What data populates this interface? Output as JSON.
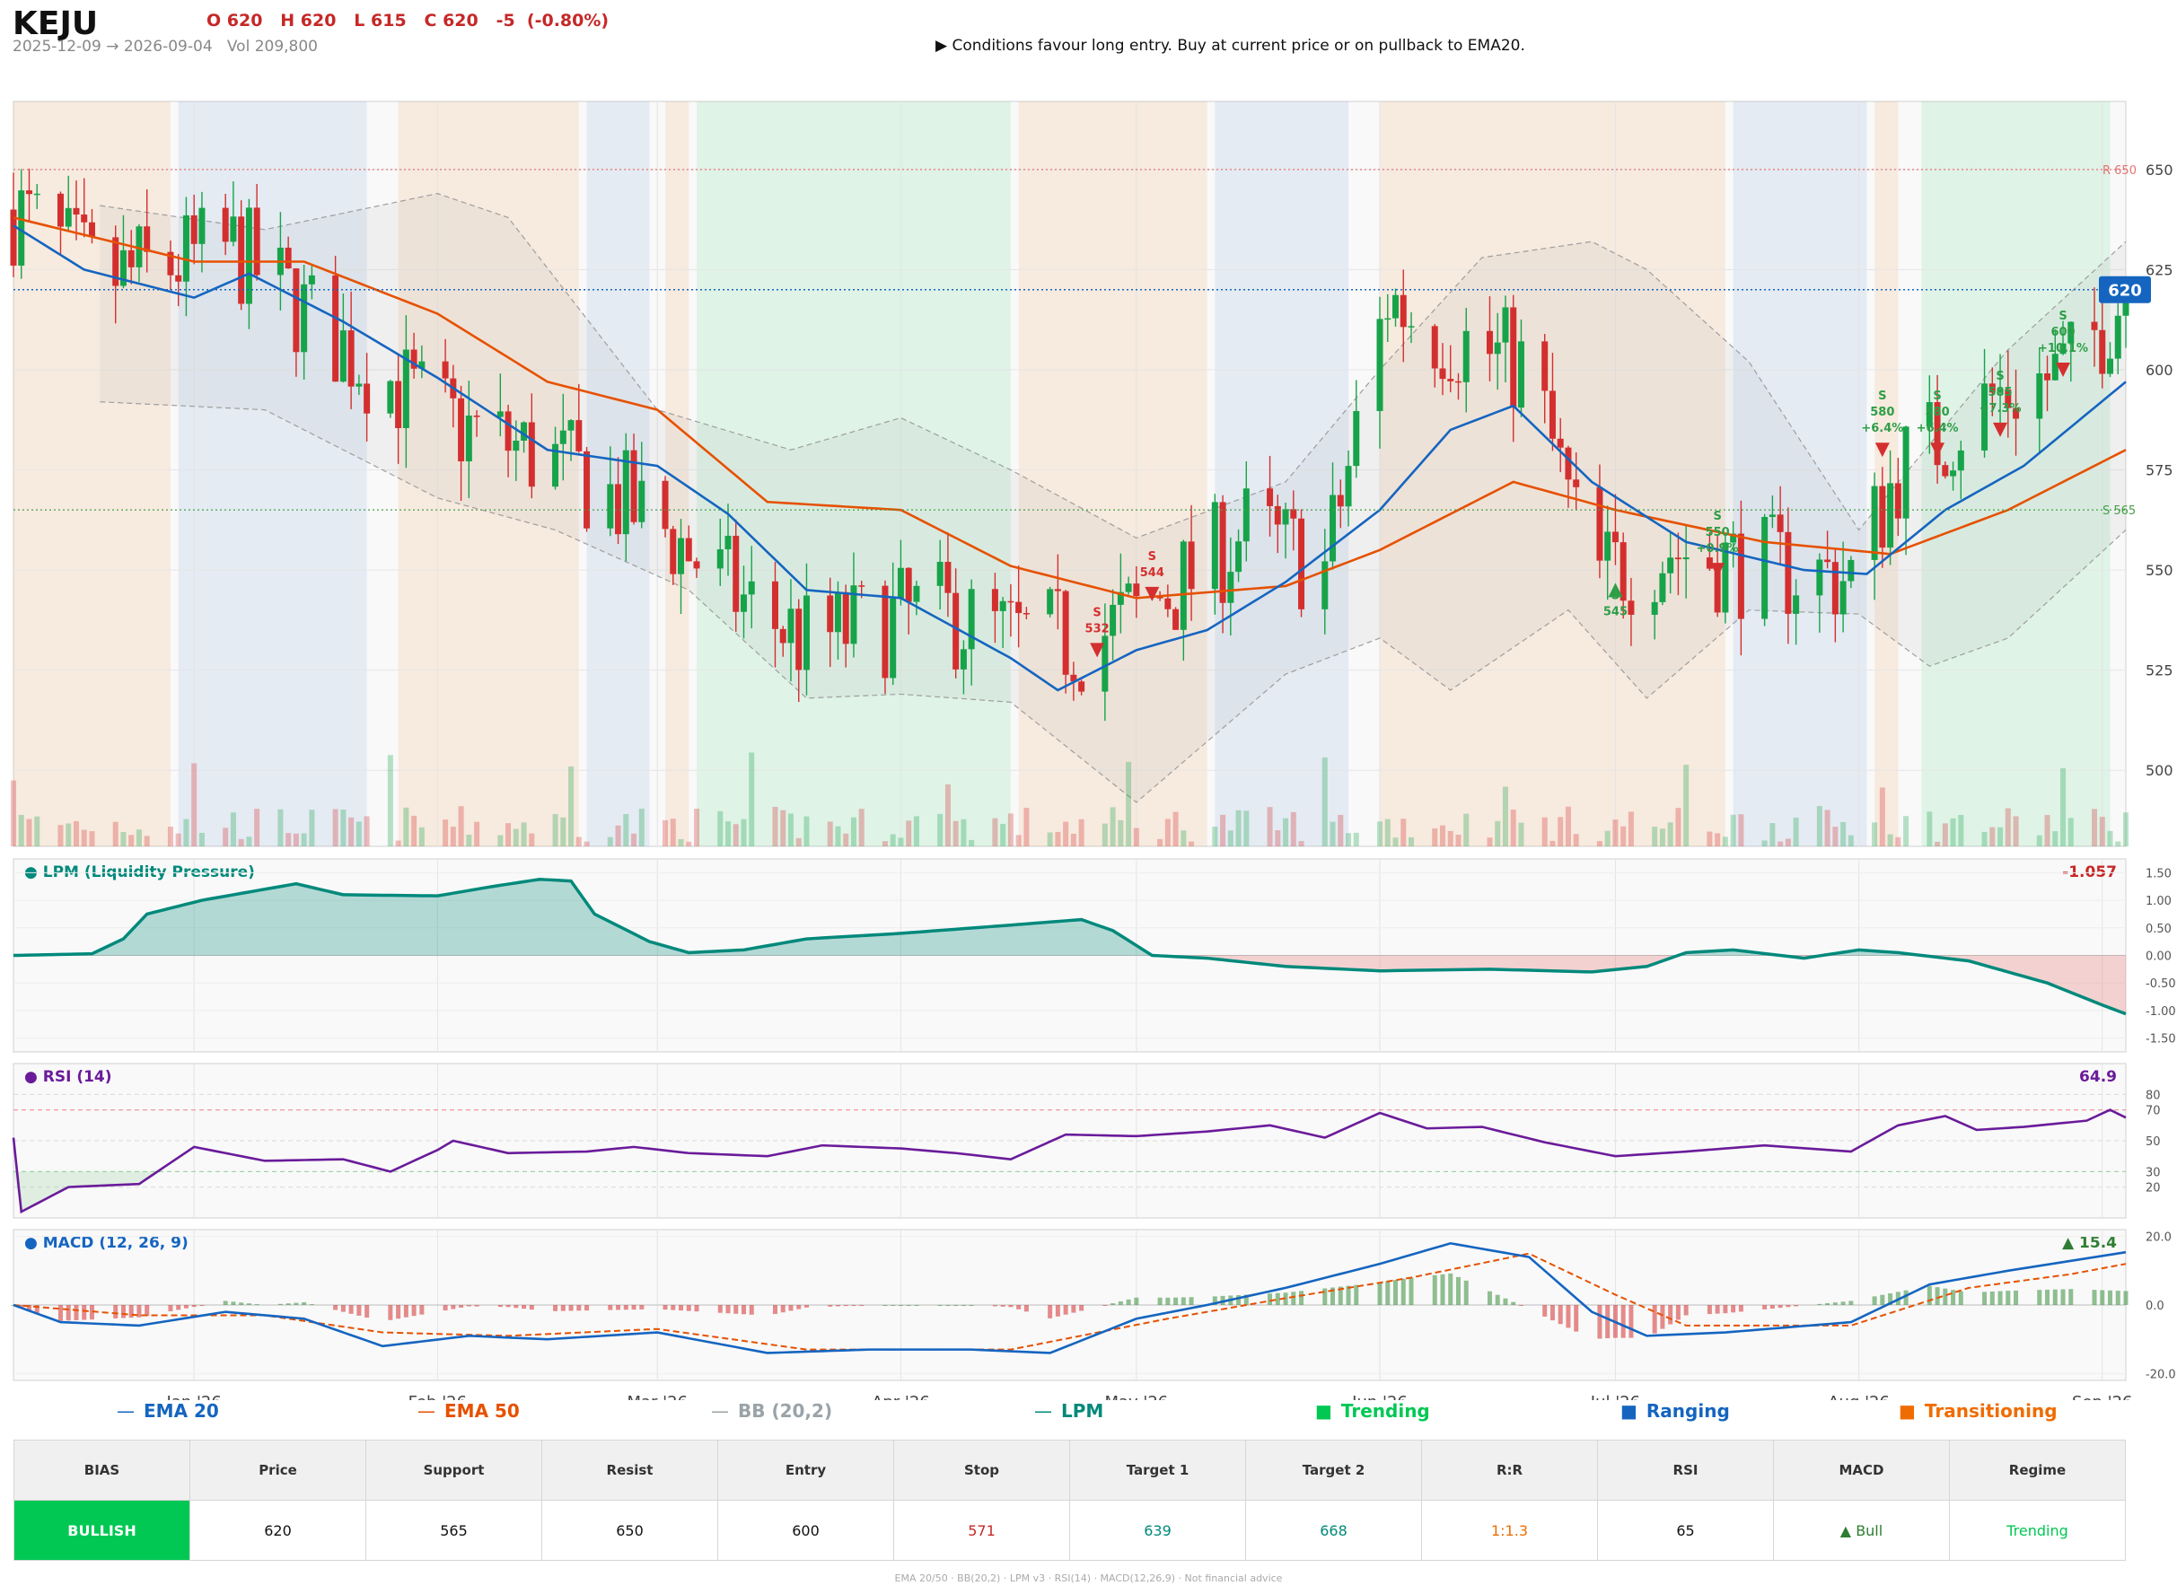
{
  "header": {
    "ticker": "KEJU",
    "ohlc": "O 620   H 620   L 615   C 620   -5  (-0.80%)",
    "date_range": "2025-12-09 → 2026-09-04   Vol 209,800",
    "signal": "▶  Conditions favour long entry. Buy at current price or on pullback to EMA20."
  },
  "legend": {
    "ema20": "EMA 20",
    "ema50": "EMA 50",
    "bb": "BB (20,2)",
    "lpm": "LPM",
    "trending": "Trending",
    "ranging": "Ranging",
    "transitioning": "Transitioning"
  },
  "summary": {
    "headers": [
      "BIAS",
      "Price",
      "Support",
      "Resist",
      "Entry",
      "Stop",
      "Target 1",
      "Target 2",
      "R:R",
      "RSI",
      "MACD",
      "Regime"
    ],
    "values": [
      "BULLISH",
      "620",
      "565",
      "650",
      "600",
      "571",
      "639",
      "668",
      "1:1.3",
      "65",
      "▲ Bull",
      "Trending"
    ],
    "value_colors": [
      "#ffffff",
      "#111111",
      "#111111",
      "#111111",
      "#111111",
      "#c62828",
      "#00897b",
      "#00897b",
      "#ef6c00",
      "#111111",
      "#2e7d32",
      "#00c853"
    ]
  },
  "footer": "EMA 20/50  ·  BB(20,2)  ·  LPM v3  ·  RSI(14)  ·  MACD(12,26,9)  ·  Not financial advice",
  "colors": {
    "up": "#17a34a",
    "down": "#d32f2f",
    "ema20": "#1565c0",
    "ema50": "#e65100",
    "bb": "#9e9e9e",
    "lpm": "#00897b",
    "rsi": "#6a1b9a",
    "macd": "#1565c0",
    "signal": "#e65100",
    "trending": "#00c853",
    "ranging": "#1565c0",
    "transitioning": "#ef6c00"
  },
  "chart_data": {
    "type": "candlestick",
    "x_range": [
      "2025-12-09",
      "2026-09-04"
    ],
    "x_ticks": [
      {
        "date": "2026-01-01",
        "label": "Jan '26"
      },
      {
        "date": "2026-02-01",
        "label": "Feb '26"
      },
      {
        "date": "2026-03-01",
        "label": "Mar '26"
      },
      {
        "date": "2026-04-01",
        "label": "Apr '26"
      },
      {
        "date": "2026-05-01",
        "label": "May '26"
      },
      {
        "date": "2026-06-01",
        "label": "Jun '26"
      },
      {
        "date": "2026-07-01",
        "label": "Jul '26"
      },
      {
        "date": "2026-08-01",
        "label": "Aug '26"
      },
      {
        "date": "2026-09-01",
        "label": "Sep '26"
      }
    ],
    "price_axis": {
      "ylim": [
        481,
        667
      ],
      "ticks": [
        500,
        525,
        550,
        575,
        600,
        625,
        650
      ]
    },
    "price_anchors": [
      [
        "2025-12-09",
        640
      ],
      [
        "2025-12-20",
        622
      ],
      [
        "2026-01-06",
        630
      ],
      [
        "2026-01-20",
        606
      ],
      [
        "2026-02-02",
        587
      ],
      [
        "2026-02-16",
        577
      ],
      [
        "2026-03-02",
        560
      ],
      [
        "2026-03-12",
        542
      ],
      [
        "2026-03-20",
        532
      ],
      [
        "2026-04-05",
        540
      ],
      [
        "2026-04-15",
        533
      ],
      [
        "2026-04-25",
        532
      ],
      [
        "2026-05-08",
        548
      ],
      [
        "2026-05-15",
        560
      ],
      [
        "2026-05-25",
        550
      ],
      [
        "2026-06-02",
        618
      ],
      [
        "2026-06-08",
        610
      ],
      [
        "2026-06-20",
        600
      ],
      [
        "2026-06-28",
        548
      ],
      [
        "2026-07-08",
        555
      ],
      [
        "2026-07-18",
        551
      ],
      [
        "2026-07-31",
        548
      ],
      [
        "2026-08-06",
        575
      ],
      [
        "2026-08-18",
        593
      ],
      [
        "2026-08-28",
        600
      ],
      [
        "2026-09-04",
        620
      ]
    ],
    "ema20": [
      [
        "2025-12-09",
        636
      ],
      [
        "2025-12-18",
        625
      ],
      [
        "2026-01-01",
        618
      ],
      [
        "2026-01-08",
        624
      ],
      [
        "2026-01-20",
        612
      ],
      [
        "2026-02-01",
        598
      ],
      [
        "2026-02-15",
        580
      ],
      [
        "2026-03-01",
        576
      ],
      [
        "2026-03-10",
        564
      ],
      [
        "2026-03-20",
        545
      ],
      [
        "2026-04-01",
        543
      ],
      [
        "2026-04-15",
        528
      ],
      [
        "2026-04-21",
        520
      ],
      [
        "2026-05-01",
        530
      ],
      [
        "2026-05-10",
        535
      ],
      [
        "2026-05-20",
        547
      ],
      [
        "2026-06-01",
        565
      ],
      [
        "2026-06-10",
        585
      ],
      [
        "2026-06-18",
        591
      ],
      [
        "2026-06-28",
        572
      ],
      [
        "2026-07-10",
        557
      ],
      [
        "2026-07-25",
        550
      ],
      [
        "2026-08-02",
        549
      ],
      [
        "2026-08-12",
        565
      ],
      [
        "2026-08-22",
        576
      ],
      [
        "2026-09-04",
        597
      ]
    ],
    "ema50": [
      [
        "2025-12-09",
        638
      ],
      [
        "2026-01-01",
        627
      ],
      [
        "2026-01-15",
        627
      ],
      [
        "2026-02-01",
        614
      ],
      [
        "2026-02-15",
        597
      ],
      [
        "2026-03-01",
        590
      ],
      [
        "2026-03-15",
        567
      ],
      [
        "2026-04-01",
        565
      ],
      [
        "2026-04-15",
        551
      ],
      [
        "2026-05-01",
        543
      ],
      [
        "2026-05-20",
        546
      ],
      [
        "2026-06-01",
        555
      ],
      [
        "2026-06-18",
        572
      ],
      [
        "2026-07-01",
        565
      ],
      [
        "2026-07-20",
        557
      ],
      [
        "2026-08-05",
        554
      ],
      [
        "2026-08-20",
        565
      ],
      [
        "2026-09-04",
        580
      ]
    ],
    "bb_upper": [
      [
        "2025-12-20",
        641
      ],
      [
        "2026-01-10",
        635
      ],
      [
        "2026-02-01",
        644
      ],
      [
        "2026-02-10",
        638
      ],
      [
        "2026-03-01",
        590
      ],
      [
        "2026-03-18",
        580
      ],
      [
        "2026-04-01",
        588
      ],
      [
        "2026-04-15",
        575
      ],
      [
        "2026-05-01",
        558
      ],
      [
        "2026-05-20",
        572
      ],
      [
        "2026-06-01",
        600
      ],
      [
        "2026-06-14",
        628
      ],
      [
        "2026-06-28",
        632
      ],
      [
        "2026-07-05",
        625
      ],
      [
        "2026-07-18",
        602
      ],
      [
        "2026-08-01",
        560
      ],
      [
        "2026-08-20",
        605
      ],
      [
        "2026-09-04",
        632
      ]
    ],
    "bb_lower": [
      [
        "2025-12-20",
        592
      ],
      [
        "2026-01-10",
        590
      ],
      [
        "2026-02-01",
        568
      ],
      [
        "2026-02-16",
        560
      ],
      [
        "2026-03-05",
        545
      ],
      [
        "2026-03-20",
        518
      ],
      [
        "2026-04-01",
        519
      ],
      [
        "2026-04-15",
        517
      ],
      [
        "2026-05-01",
        492
      ],
      [
        "2026-05-20",
        524
      ],
      [
        "2026-06-01",
        533
      ],
      [
        "2026-06-10",
        520
      ],
      [
        "2026-06-25",
        540
      ],
      [
        "2026-07-05",
        518
      ],
      [
        "2026-07-18",
        540
      ],
      [
        "2026-08-01",
        539
      ],
      [
        "2026-08-10",
        526
      ],
      [
        "2026-08-20",
        533
      ],
      [
        "2026-09-04",
        560
      ]
    ],
    "levels": [
      {
        "label": "R 650",
        "value": 650,
        "color": "#e57373"
      },
      {
        "label": "S 565",
        "value": 565,
        "color": "#43a047"
      }
    ],
    "last_price": {
      "value": 620,
      "label": "620"
    },
    "regimes": [
      {
        "start": "2025-12-09",
        "end": "2025-12-29",
        "type": "transitioning"
      },
      {
        "start": "2025-12-30",
        "end": "2026-01-23",
        "type": "ranging"
      },
      {
        "start": "2026-01-27",
        "end": "2026-02-19",
        "type": "transitioning"
      },
      {
        "start": "2026-02-20",
        "end": "2026-02-28",
        "type": "ranging"
      },
      {
        "start": "2026-03-02",
        "end": "2026-03-05",
        "type": "transitioning"
      },
      {
        "start": "2026-03-06",
        "end": "2026-04-15",
        "type": "trending"
      },
      {
        "start": "2026-04-16",
        "end": "2026-05-10",
        "type": "transitioning"
      },
      {
        "start": "2026-05-11",
        "end": "2026-05-28",
        "type": "ranging"
      },
      {
        "start": "2026-06-01",
        "end": "2026-07-15",
        "type": "transitioning"
      },
      {
        "start": "2026-07-16",
        "end": "2026-08-02",
        "type": "ranging"
      },
      {
        "start": "2026-08-03",
        "end": "2026-08-06",
        "type": "transitioning"
      },
      {
        "start": "2026-08-09",
        "end": "2026-09-02",
        "type": "trending"
      }
    ],
    "trade_markers": [
      {
        "date": "2026-04-26",
        "price": 530,
        "dir": "sell",
        "lines": [
          "S",
          "532"
        ],
        "color": "#d32f2f"
      },
      {
        "date": "2026-05-03",
        "price": 544,
        "dir": "sell",
        "lines": [
          "S",
          "544"
        ],
        "color": "#d32f2f"
      },
      {
        "date": "2026-07-01",
        "price": 545,
        "dir": "buy",
        "lines": [
          "S",
          "545"
        ],
        "color": "#2e9e47"
      },
      {
        "date": "2026-07-14",
        "price": 550,
        "dir": "sell",
        "lines": [
          "S",
          "550",
          "+0.9%"
        ],
        "color": "#2e9e47"
      },
      {
        "date": "2026-08-04",
        "price": 580,
        "dir": "sell",
        "lines": [
          "S",
          "580",
          "+6.4%"
        ],
        "color": "#2e9e47"
      },
      {
        "date": "2026-08-11",
        "price": 580,
        "dir": "sell",
        "lines": [
          "S",
          "580",
          "+6.4%"
        ],
        "color": "#2e9e47"
      },
      {
        "date": "2026-08-19",
        "price": 585,
        "dir": "sell",
        "lines": [
          "S",
          "585",
          "+7.3%"
        ],
        "color": "#2e9e47"
      },
      {
        "date": "2026-08-27",
        "price": 600,
        "dir": "sell",
        "lines": [
          "S",
          "600",
          "+10.1%"
        ],
        "color": "#2e9e47"
      }
    ],
    "lpm": {
      "title": "LPM (Liquidity Pressure)",
      "last_value": "-1.057",
      "ylim": [
        -1.75,
        1.75
      ],
      "ticks": [
        1.5,
        1.0,
        0.5,
        0.0,
        -0.5,
        -1.0,
        -1.5
      ],
      "tick_labels": [
        "1.50",
        "1.00",
        "0.50",
        "0.00",
        "-0.50",
        "-1.00",
        "-1.50"
      ],
      "points": [
        [
          "2025-12-09",
          0.0
        ],
        [
          "2025-12-19",
          0.03
        ],
        [
          "2025-12-23",
          0.3
        ],
        [
          "2025-12-26",
          0.75
        ],
        [
          "2026-01-02",
          1.0
        ],
        [
          "2026-01-08",
          1.15
        ],
        [
          "2026-01-14",
          1.3
        ],
        [
          "2026-01-20",
          1.1
        ],
        [
          "2026-02-01",
          1.08
        ],
        [
          "2026-02-08",
          1.25
        ],
        [
          "2026-02-14",
          1.38
        ],
        [
          "2026-02-18",
          1.35
        ],
        [
          "2026-02-21",
          0.75
        ],
        [
          "2026-02-28",
          0.25
        ],
        [
          "2026-03-05",
          0.05
        ],
        [
          "2026-03-12",
          0.1
        ],
        [
          "2026-03-20",
          0.3
        ],
        [
          "2026-04-01",
          0.4
        ],
        [
          "2026-04-15",
          0.55
        ],
        [
          "2026-04-24",
          0.65
        ],
        [
          "2026-04-28",
          0.45
        ],
        [
          "2026-05-03",
          0.0
        ],
        [
          "2026-05-10",
          -0.05
        ],
        [
          "2026-05-20",
          -0.2
        ],
        [
          "2026-06-01",
          -0.28
        ],
        [
          "2026-06-15",
          -0.25
        ],
        [
          "2026-06-28",
          -0.3
        ],
        [
          "2026-07-05",
          -0.2
        ],
        [
          "2026-07-10",
          0.05
        ],
        [
          "2026-07-16",
          0.1
        ],
        [
          "2026-07-25",
          -0.05
        ],
        [
          "2026-08-01",
          0.1
        ],
        [
          "2026-08-06",
          0.05
        ],
        [
          "2026-08-15",
          -0.1
        ],
        [
          "2026-08-25",
          -0.5
        ],
        [
          "2026-09-01",
          -0.9
        ],
        [
          "2026-09-04",
          -1.06
        ]
      ]
    },
    "rsi": {
      "title": "RSI (14)",
      "last_value": "64.9",
      "ylim": [
        0,
        100
      ],
      "ticks": [
        80,
        70,
        50,
        30,
        20
      ],
      "overbought": 70,
      "oversold": 30,
      "points": [
        [
          "2025-12-09",
          52
        ],
        [
          "2025-12-10",
          4
        ],
        [
          "2025-12-16",
          20
        ],
        [
          "2025-12-25",
          22
        ],
        [
          "2026-01-01",
          46
        ],
        [
          "2026-01-10",
          37
        ],
        [
          "2026-01-20",
          38
        ],
        [
          "2026-01-26",
          30
        ],
        [
          "2026-02-01",
          44
        ],
        [
          "2026-02-03",
          50
        ],
        [
          "2026-02-10",
          42
        ],
        [
          "2026-02-20",
          43
        ],
        [
          "2026-02-26",
          46
        ],
        [
          "2026-03-05",
          42
        ],
        [
          "2026-03-15",
          40
        ],
        [
          "2026-03-22",
          47
        ],
        [
          "2026-04-01",
          45
        ],
        [
          "2026-04-08",
          42
        ],
        [
          "2026-04-15",
          38
        ],
        [
          "2026-04-22",
          54
        ],
        [
          "2026-05-01",
          53
        ],
        [
          "2026-05-10",
          56
        ],
        [
          "2026-05-18",
          60
        ],
        [
          "2026-05-25",
          52
        ],
        [
          "2026-06-01",
          68
        ],
        [
          "2026-06-07",
          58
        ],
        [
          "2026-06-14",
          59
        ],
        [
          "2026-06-22",
          49
        ],
        [
          "2026-07-01",
          40
        ],
        [
          "2026-07-10",
          43
        ],
        [
          "2026-07-20",
          47
        ],
        [
          "2026-07-31",
          43
        ],
        [
          "2026-08-06",
          60
        ],
        [
          "2026-08-12",
          66
        ],
        [
          "2026-08-16",
          57
        ],
        [
          "2026-08-22",
          59
        ],
        [
          "2026-08-30",
          63
        ],
        [
          "2026-09-02",
          70
        ],
        [
          "2026-09-04",
          65
        ]
      ]
    },
    "macd": {
      "title": "MACD (12, 26, 9)",
      "last_value": "▲ 15.4",
      "ylim": [
        -22,
        22
      ],
      "ticks": [
        20,
        0,
        -20
      ],
      "tick_labels": [
        "20.0",
        "0.0",
        "-20.0"
      ],
      "macd_points": [
        [
          "2025-12-09",
          0
        ],
        [
          "2025-12-15",
          -5
        ],
        [
          "2025-12-25",
          -6
        ],
        [
          "2026-01-05",
          -2
        ],
        [
          "2026-01-15",
          -4
        ],
        [
          "2026-01-25",
          -12
        ],
        [
          "2026-02-05",
          -9
        ],
        [
          "2026-02-15",
          -10
        ],
        [
          "2026-03-01",
          -8
        ],
        [
          "2026-03-15",
          -14
        ],
        [
          "2026-03-28",
          -13
        ],
        [
          "2026-04-10",
          -13
        ],
        [
          "2026-04-20",
          -14
        ],
        [
          "2026-05-01",
          -4
        ],
        [
          "2026-05-10",
          0
        ],
        [
          "2026-05-20",
          5
        ],
        [
          "2026-06-01",
          12
        ],
        [
          "2026-06-10",
          18
        ],
        [
          "2026-06-20",
          14
        ],
        [
          "2026-06-28",
          -2
        ],
        [
          "2026-07-05",
          -9
        ],
        [
          "2026-07-15",
          -8
        ],
        [
          "2026-07-31",
          -5
        ],
        [
          "2026-08-10",
          6
        ],
        [
          "2026-08-20",
          10
        ],
        [
          "2026-09-04",
          15.4
        ]
      ],
      "signal_points": [
        [
          "2025-12-09",
          0
        ],
        [
          "2025-12-25",
          -3
        ],
        [
          "2026-01-10",
          -3
        ],
        [
          "2026-01-25",
          -8
        ],
        [
          "2026-02-10",
          -9
        ],
        [
          "2026-03-01",
          -7
        ],
        [
          "2026-03-20",
          -13
        ],
        [
          "2026-04-15",
          -13
        ],
        [
          "2026-05-05",
          -4
        ],
        [
          "2026-05-20",
          2
        ],
        [
          "2026-06-05",
          8
        ],
        [
          "2026-06-20",
          15
        ],
        [
          "2026-07-01",
          3
        ],
        [
          "2026-07-10",
          -6
        ],
        [
          "2026-07-31",
          -6
        ],
        [
          "2026-08-15",
          5
        ],
        [
          "2026-08-28",
          9
        ],
        [
          "2026-09-04",
          12
        ]
      ]
    },
    "x_axis_labels": [
      "Jan '26",
      "Feb '26",
      "Mar '26",
      "Apr '26",
      "May '26",
      "Jun '26",
      "Jul '26",
      "Aug '26",
      "Sep '26"
    ]
  }
}
